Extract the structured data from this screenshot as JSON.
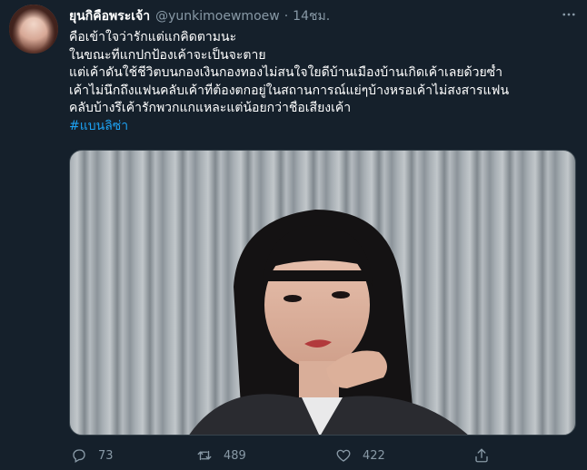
{
  "tweet": {
    "display_name": "ยุนกิคือพระเจ้า",
    "handle": "@yunkimoewmoew",
    "separator": "·",
    "time": "14ชม.",
    "lines": [
      "คือเข้าใจว่ารักแต่แกคิดตามนะ",
      "ในขณะที่แกปกป้องเค้าจะเป็นจะตาย",
      "แต่เค้าดันใช้ชีวิตบนกองเงินกองทองไม่สนใจใยดีบ้านเมืองบ้านเกิดเค้าเลยด้วยซ้ำ",
      "เค้าไม่นึกถึงแฟนคลับเค้าที่ต้องตกอยู่ในสถานการณ์แย่ๆบ้างหรอเค้าไม่สงสารแฟน",
      "คลับบ้างรึเค้ารักพวกแกแหละแต่น้อยกว่าชื่อเสียงเค้า"
    ],
    "hashtag": "#แบนลิซ่า"
  },
  "actions": {
    "reply_count": "73",
    "retweet_count": "489",
    "like_count": "422"
  },
  "icons": {
    "more": "more-icon",
    "reply": "reply-icon",
    "retweet": "retweet-icon",
    "like": "heart-icon",
    "share": "share-icon"
  },
  "colors": {
    "background": "#15202b",
    "muted_text": "#8899a6",
    "link": "#1da1f2",
    "border": "#38444d"
  }
}
